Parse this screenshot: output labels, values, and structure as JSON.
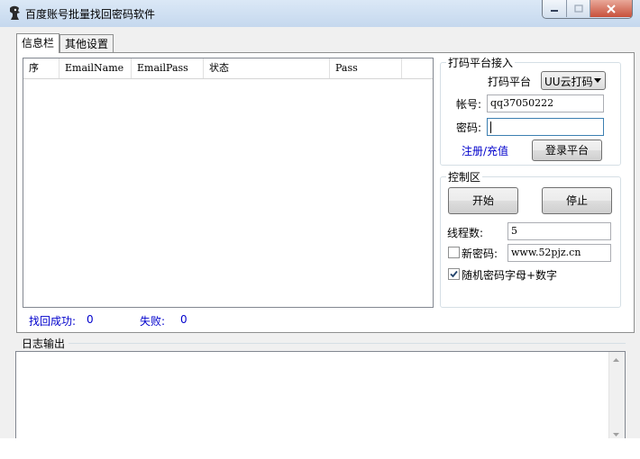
{
  "window": {
    "title": "百度账号批量找回密码软件",
    "min_label": "▁",
    "max_label": "▢",
    "close_label": "✕"
  },
  "tabs": [
    {
      "label": "信息栏"
    },
    {
      "label": "其他设置"
    }
  ],
  "list": {
    "columns": [
      "序",
      "EmailName",
      "EmailPass",
      "状态",
      "Pass"
    ],
    "rows": []
  },
  "stats": {
    "success_label": "找回成功:",
    "success_value": "0",
    "fail_label": "失败:",
    "fail_value": "0"
  },
  "captcha": {
    "group_title": "打码平台接入",
    "platform_label": "打码平台",
    "platform_value": "UU云打码",
    "account_label": "帐号:",
    "account_value": "qq37050222",
    "password_label": "密码:",
    "password_value": "",
    "register_link": "注册/充值",
    "login_button": "登录平台"
  },
  "control": {
    "group_title": "控制区",
    "start_button": "开始",
    "stop_button": "停止",
    "threads_label": "线程数:",
    "threads_value": "5",
    "new_password_label": "新密码:",
    "new_password_value": "www.52pjz.cn",
    "new_password_checked": false,
    "random_label": "随机密码字母+数字",
    "random_checked": true
  },
  "log": {
    "label": "日志输出"
  }
}
